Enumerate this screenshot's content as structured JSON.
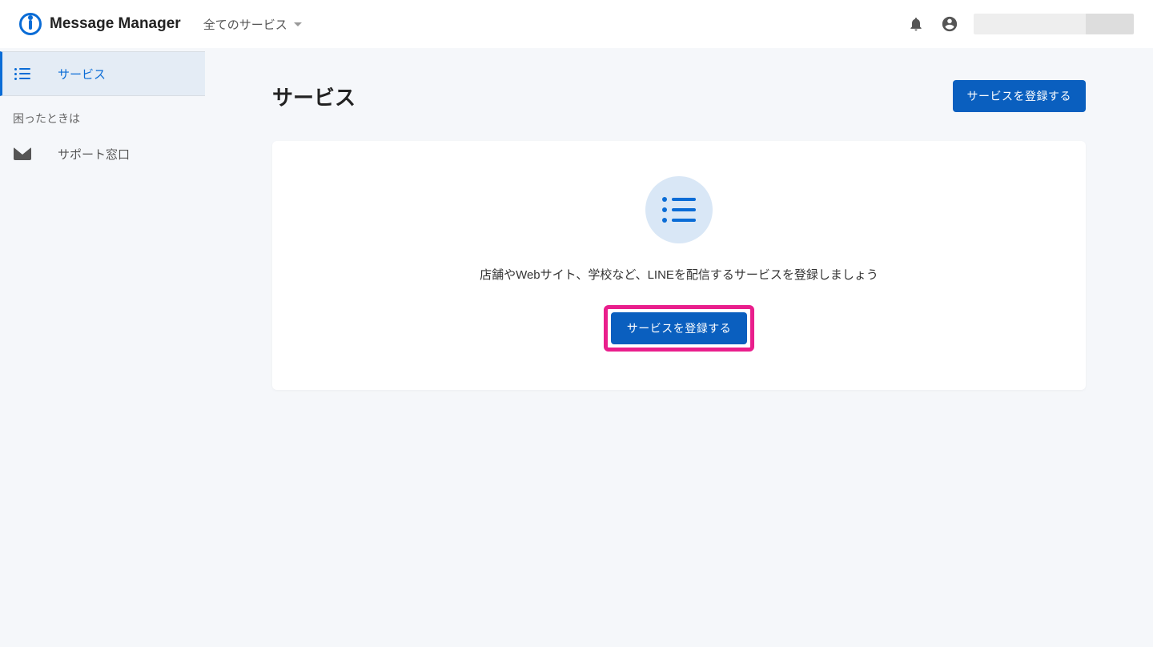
{
  "header": {
    "app_name": "Message Manager",
    "switcher_label": "全てのサービス"
  },
  "sidebar": {
    "items": [
      {
        "label": "サービス"
      }
    ],
    "help_section_title": "困ったときは",
    "help_item_label": "サポート窓口"
  },
  "page": {
    "title": "サービス",
    "register_button": "サービスを登録する"
  },
  "empty_state": {
    "text": "店舗やWebサイト、学校など、LINEを配信するサービスを登録しましょう",
    "button": "サービスを登録する"
  }
}
